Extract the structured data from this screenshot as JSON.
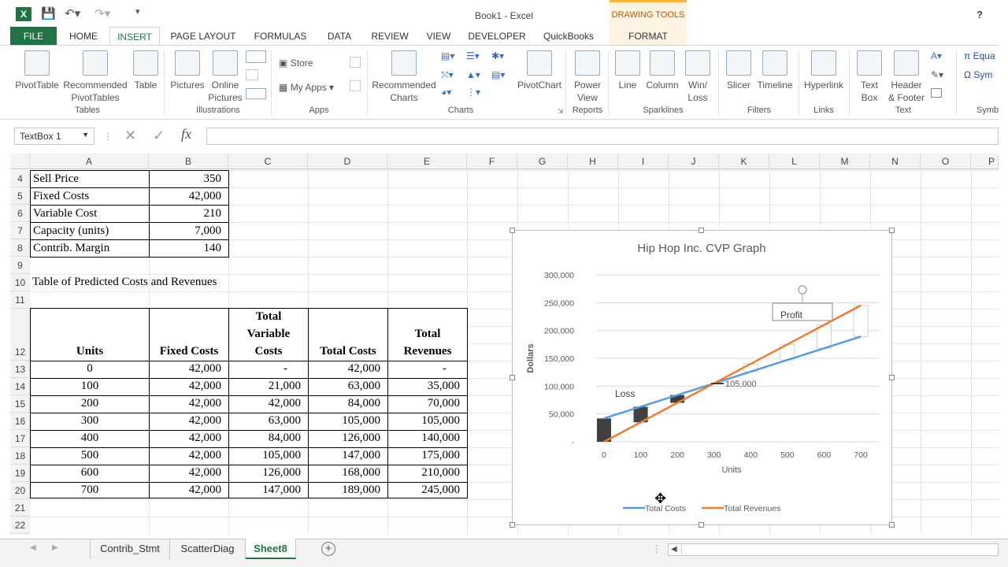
{
  "window": {
    "title": "Book1 - Excel",
    "drawing_tools": "DRAWING TOOLS",
    "help": "?"
  },
  "tabs": [
    "FILE",
    "HOME",
    "INSERT",
    "PAGE LAYOUT",
    "FORMULAS",
    "DATA",
    "REVIEW",
    "VIEW",
    "DEVELOPER",
    "QuickBooks",
    "FORMAT"
  ],
  "ribbon": {
    "pivottable": "PivotTable",
    "rec_pivot_1": "Recommended",
    "rec_pivot_2": "PivotTables",
    "table": "Table",
    "pictures": "Pictures",
    "online_1": "Online",
    "online_2": "Pictures",
    "store": "Store",
    "myapps": "My Apps",
    "rec_charts_1": "Recommended",
    "rec_charts_2": "Charts",
    "pivotchart": "PivotChart",
    "power_1": "Power",
    "power_2": "View",
    "line": "Line",
    "column": "Column",
    "winloss_1": "Win/",
    "winloss_2": "Loss",
    "slicer": "Slicer",
    "timeline": "Timeline",
    "hyperlink": "Hyperlink",
    "textbox_1": "Text",
    "textbox_2": "Box",
    "header_1": "Header",
    "header_2": "& Footer",
    "equation": "Equa",
    "symbol": "Sym",
    "groups": {
      "tables": "Tables",
      "illustrations": "Illustrations",
      "apps": "Apps",
      "charts": "Charts",
      "reports": "Reports",
      "sparklines": "Sparklines",
      "filters": "Filters",
      "links": "Links",
      "text": "Text",
      "symbols": "Symb"
    }
  },
  "formula_bar": {
    "name_box": "TextBox 1",
    "fx": "fx",
    "value": ""
  },
  "columns": [
    "A",
    "B",
    "C",
    "D",
    "E",
    "F",
    "G",
    "H",
    "I",
    "J",
    "K",
    "L",
    "M",
    "N",
    "O",
    "P"
  ],
  "rows": [
    "4",
    "5",
    "6",
    "7",
    "8",
    "9",
    "10",
    "11",
    "12",
    "13",
    "14",
    "15",
    "16",
    "17",
    "18",
    "19",
    "20",
    "21",
    "22"
  ],
  "inputs": [
    {
      "label": "Sell Price",
      "value": "350"
    },
    {
      "label": "Fixed Costs",
      "value": "42,000"
    },
    {
      "label": "Variable Cost",
      "value": "210"
    },
    {
      "label": "Capacity (units)",
      "value": "7,000"
    },
    {
      "label": "Contrib. Margin",
      "value": "140"
    }
  ],
  "table_title": "Table of Predicted Costs and Revenues",
  "table_headers": {
    "units": "Units",
    "fixed": "Fixed Costs",
    "var_1": "Total",
    "var_2": "Variable",
    "var_3": "Costs",
    "total": "Total Costs",
    "rev_1": "Total",
    "rev_2": "Revenues"
  },
  "table_rows": [
    [
      "0",
      "42,000",
      "-",
      "42,000",
      "-"
    ],
    [
      "100",
      "42,000",
      "21,000",
      "63,000",
      "35,000"
    ],
    [
      "200",
      "42,000",
      "42,000",
      "84,000",
      "70,000"
    ],
    [
      "300",
      "42,000",
      "63,000",
      "105,000",
      "105,000"
    ],
    [
      "400",
      "42,000",
      "84,000",
      "126,000",
      "140,000"
    ],
    [
      "500",
      "42,000",
      "105,000",
      "147,000",
      "175,000"
    ],
    [
      "600",
      "42,000",
      "126,000",
      "168,000",
      "210,000"
    ],
    [
      "700",
      "42,000",
      "147,000",
      "189,000",
      "245,000"
    ]
  ],
  "sheets": [
    "Contrib_Stmt",
    "ScatterDiag",
    "Sheet8"
  ],
  "colors": {
    "excel_green": "#217346",
    "total_costs": "#5b9bd5",
    "total_revenues": "#ed7d31",
    "loss_bar": "#404040"
  },
  "chart_data": {
    "type": "line",
    "title": "Hip Hop Inc. CVP Graph",
    "xlabel": "Units",
    "ylabel": "Dollars",
    "x": [
      0,
      100,
      200,
      300,
      400,
      500,
      600,
      700
    ],
    "x_tick_labels": [
      "0",
      "100",
      "200",
      "300",
      "400",
      "500",
      "600",
      "700"
    ],
    "y_tick_labels": [
      "-",
      "50,000",
      "100,000",
      "150,000",
      "200,000",
      "250,000",
      "300,000"
    ],
    "ylim": [
      0,
      300000
    ],
    "grid": true,
    "legend_position": "bottom",
    "series": [
      {
        "name": "Total Costs",
        "values": [
          42000,
          63000,
          84000,
          105000,
          126000,
          147000,
          168000,
          189000
        ],
        "color": "#5b9bd5"
      },
      {
        "name": "Total Revenues",
        "values": [
          0,
          35000,
          70000,
          105000,
          140000,
          175000,
          210000,
          245000
        ],
        "color": "#ed7d31"
      }
    ],
    "annotations": {
      "breakeven": "105,000",
      "loss": "Loss",
      "profit": "Profit"
    }
  }
}
